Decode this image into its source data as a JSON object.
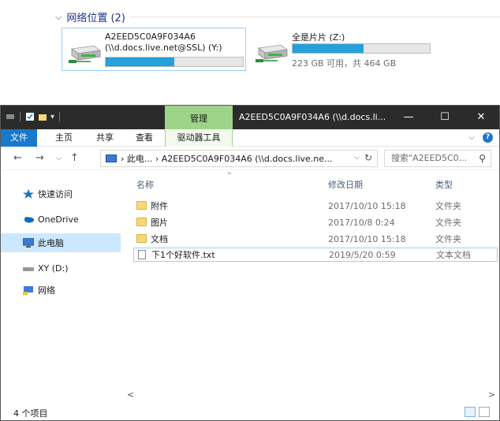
{
  "network_group": {
    "chevron": "⌵",
    "title": "网络位置 (2)",
    "drives": [
      {
        "name": "A2EED5C0A9F034A6",
        "sub": "(\\\\d.docs.live.net@SSL) (Y:)",
        "used_fraction": 0.5,
        "space": ""
      },
      {
        "name": "全是片片 (Z:)",
        "sub": "",
        "used_fraction": 0.52,
        "space": "223 GB 可用，共 464 GB"
      }
    ]
  },
  "window": {
    "title": "A2EED5C0A9F034A6 (\\\\d.docs.li...",
    "context_tab": "管理",
    "minimize": "—",
    "maximize": "☐",
    "close": "✕",
    "accent": "#1979ca",
    "context_color": "#9ed38a"
  },
  "ribbon": {
    "tabs": [
      "文件",
      "主页",
      "共享",
      "查看",
      "驱动器工具"
    ],
    "collapse": "⌵",
    "help": "?"
  },
  "address": {
    "back": "←",
    "forward": "→",
    "recent": "⌵",
    "up": "↑",
    "path": "› 此电... › A2EED5C0A9F034A6 (\\\\d.docs.live.ne...",
    "dropdown": "⌵",
    "refresh": "↻",
    "search_placeholder": "搜索\"A2EED5C0...",
    "search_icon": "⚲"
  },
  "nav": {
    "items": [
      {
        "label": "快速访问",
        "icon": "star-icon"
      },
      {
        "label": "OneDrive",
        "icon": "cloud-icon"
      },
      {
        "label": "此电脑",
        "icon": "computer-icon"
      },
      {
        "label": "XY (D:)",
        "icon": "drive-icon"
      },
      {
        "label": "网络",
        "icon": "network-icon"
      }
    ]
  },
  "columns": {
    "name": "名称",
    "date": "修改日期",
    "type": "类型",
    "sort_caret": "^"
  },
  "files": [
    {
      "name": "附件",
      "date": "2017/10/10 15:18",
      "type": "文件夹",
      "icon": "folder-icon"
    },
    {
      "name": "图片",
      "date": "2017/10/8 0:24",
      "type": "文件夹",
      "icon": "folder-icon"
    },
    {
      "name": "文档",
      "date": "2017/10/10 15:18",
      "type": "文件夹",
      "icon": "folder-icon"
    },
    {
      "name": "下1个好软件.txt",
      "date": "2019/5/20 0:59",
      "type": "文本文档",
      "icon": "text-file-icon"
    }
  ],
  "scroll": {
    "left": "<",
    "right": ">"
  },
  "status": {
    "count": "4 个项目"
  }
}
